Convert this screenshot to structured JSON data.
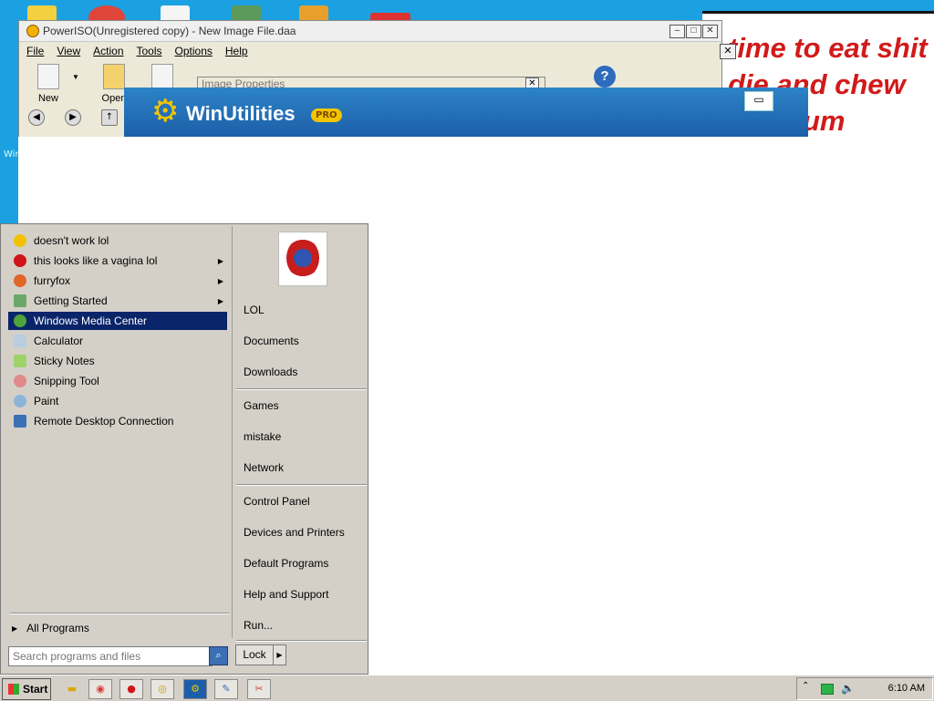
{
  "desktop": {
    "wallpaper_lines": [
      "time to eat shit",
      "die and chew",
      "um"
    ],
    "side_label": "Win"
  },
  "poweriso": {
    "title": "PowerISO(Unregistered copy) - New Image File.daa",
    "menu": [
      "File",
      "View",
      "Action",
      "Tools",
      "Options",
      "Help"
    ],
    "toolbar": {
      "new_label": "New",
      "open_label": "Open"
    },
    "help_icon": "?"
  },
  "image_properties": {
    "title": "Image Properties"
  },
  "winutilities": {
    "title": "WinUtilities",
    "badge": "PRO"
  },
  "start_menu": {
    "pinned": [
      {
        "label": "doesn't work lol",
        "icon": "smiley-icon",
        "arrow": false
      },
      {
        "label": "this looks like a vagina lol",
        "icon": "opera-icon",
        "arrow": true
      },
      {
        "label": "furryfox",
        "icon": "firefox-icon",
        "arrow": true
      },
      {
        "label": "Getting Started",
        "icon": "getting-started-icon",
        "arrow": true
      },
      {
        "label": "Windows Media Center",
        "icon": "media-center-icon",
        "arrow": false,
        "highlighted": true
      },
      {
        "label": "Calculator",
        "icon": "calculator-icon",
        "arrow": false
      },
      {
        "label": "Sticky Notes",
        "icon": "sticky-notes-icon",
        "arrow": false
      },
      {
        "label": "Snipping Tool",
        "icon": "snipping-tool-icon",
        "arrow": false
      },
      {
        "label": "Paint",
        "icon": "paint-icon",
        "arrow": false
      },
      {
        "label": "Remote Desktop Connection",
        "icon": "remote-desktop-icon",
        "arrow": false
      }
    ],
    "all_programs": "All Programs",
    "search_placeholder": "Search programs and files",
    "right_items": [
      {
        "label": "LOL"
      },
      {
        "label": "Documents"
      },
      {
        "label": "Downloads"
      },
      {
        "label": "Games"
      },
      {
        "label": "mistake"
      },
      {
        "label": "Network"
      },
      {
        "label": "Control Panel"
      },
      {
        "label": "Devices and Printers"
      },
      {
        "label": "Default Programs"
      },
      {
        "label": "Help and Support"
      },
      {
        "label": "Run..."
      }
    ],
    "lock_label": "Lock"
  },
  "taskbar": {
    "start_label": "Start",
    "clock": "6:10 AM",
    "pinned": [
      "folder-icon",
      "chrome-icon",
      "opera-icon",
      "poweriso-icon",
      "winutilities-icon",
      "paint-icon",
      "snipping-tool-icon"
    ]
  },
  "colors": {
    "highlight": "#0a246a",
    "desktop": "#1ba1e2",
    "winutil_blue": "#1c5fa8",
    "wallpaper_text": "#d11a1a"
  }
}
